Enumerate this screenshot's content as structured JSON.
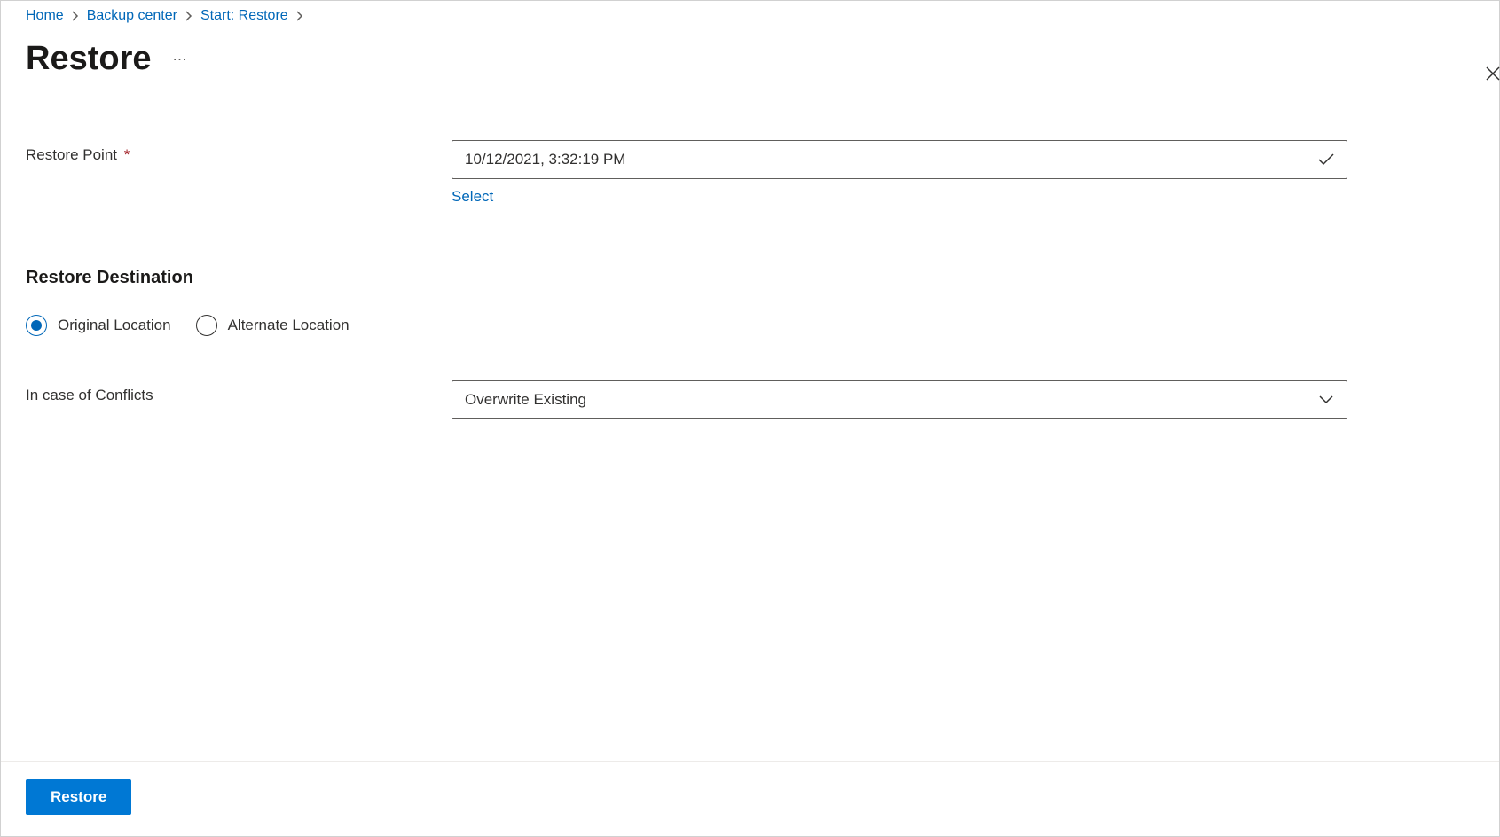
{
  "breadcrumb": {
    "items": [
      {
        "label": "Home"
      },
      {
        "label": "Backup center"
      },
      {
        "label": "Start: Restore"
      }
    ]
  },
  "header": {
    "title": "Restore"
  },
  "form": {
    "restorePoint": {
      "label": "Restore Point",
      "value": "10/12/2021, 3:32:19 PM",
      "selectLink": "Select"
    },
    "destination": {
      "sectionTitle": "Restore Destination",
      "options": {
        "original": "Original Location",
        "alternate": "Alternate Location"
      }
    },
    "conflicts": {
      "label": "In case of Conflicts",
      "value": "Overwrite Existing"
    }
  },
  "footer": {
    "restoreButton": "Restore"
  }
}
